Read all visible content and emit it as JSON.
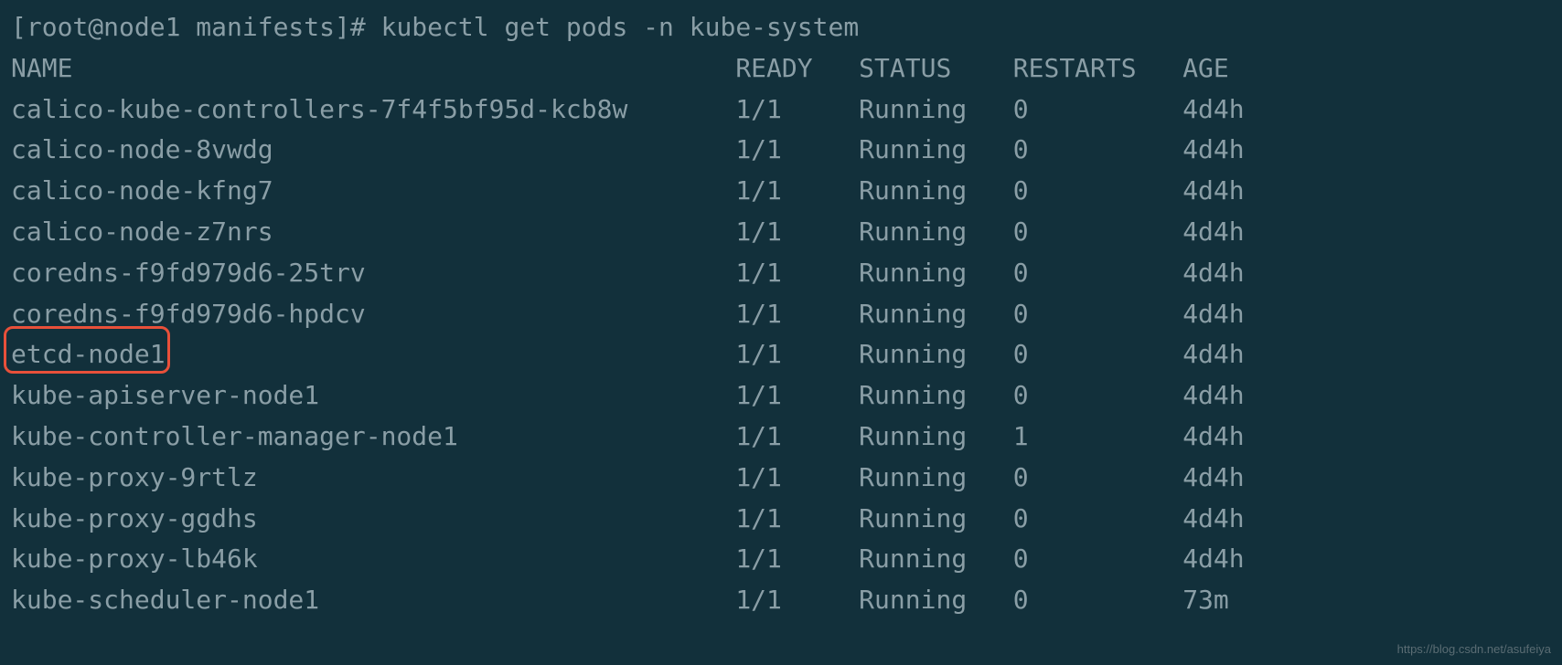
{
  "prompt": {
    "user_host": "[root@node1 manifests]#",
    "command": "kubectl get pods -n kube-system"
  },
  "headers": {
    "name": "NAME",
    "ready": "READY",
    "status": "STATUS",
    "restarts": "RESTARTS",
    "age": "AGE"
  },
  "rows": [
    {
      "name": "calico-kube-controllers-7f4f5bf95d-kcb8w",
      "ready": "1/1",
      "status": "Running",
      "restarts": "0",
      "age": "4d4h"
    },
    {
      "name": "calico-node-8vwdg",
      "ready": "1/1",
      "status": "Running",
      "restarts": "0",
      "age": "4d4h"
    },
    {
      "name": "calico-node-kfng7",
      "ready": "1/1",
      "status": "Running",
      "restarts": "0",
      "age": "4d4h"
    },
    {
      "name": "calico-node-z7nrs",
      "ready": "1/1",
      "status": "Running",
      "restarts": "0",
      "age": "4d4h"
    },
    {
      "name": "coredns-f9fd979d6-25trv",
      "ready": "1/1",
      "status": "Running",
      "restarts": "0",
      "age": "4d4h"
    },
    {
      "name": "coredns-f9fd979d6-hpdcv",
      "ready": "1/1",
      "status": "Running",
      "restarts": "0",
      "age": "4d4h"
    },
    {
      "name": "etcd-node1",
      "ready": "1/1",
      "status": "Running",
      "restarts": "0",
      "age": "4d4h"
    },
    {
      "name": "kube-apiserver-node1",
      "ready": "1/1",
      "status": "Running",
      "restarts": "0",
      "age": "4d4h"
    },
    {
      "name": "kube-controller-manager-node1",
      "ready": "1/1",
      "status": "Running",
      "restarts": "1",
      "age": "4d4h"
    },
    {
      "name": "kube-proxy-9rtlz",
      "ready": "1/1",
      "status": "Running",
      "restarts": "0",
      "age": "4d4h"
    },
    {
      "name": "kube-proxy-ggdhs",
      "ready": "1/1",
      "status": "Running",
      "restarts": "0",
      "age": "4d4h"
    },
    {
      "name": "kube-proxy-lb46k",
      "ready": "1/1",
      "status": "Running",
      "restarts": "0",
      "age": "4d4h"
    },
    {
      "name": "kube-scheduler-node1",
      "ready": "1/1",
      "status": "Running",
      "restarts": "0",
      "age": "73m"
    }
  ],
  "highlighted_row_index": 6,
  "watermark": "https://blog.csdn.net/asufeiya"
}
